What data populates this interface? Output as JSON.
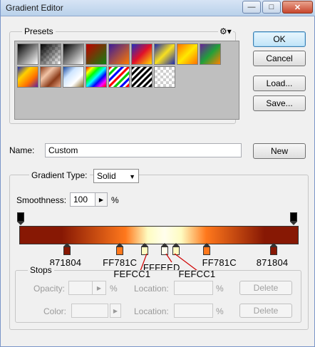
{
  "window": {
    "title": "Gradient Editor",
    "controls": [
      "minimize",
      "maximize",
      "close"
    ]
  },
  "presets": {
    "label": "Presets",
    "menu_icon": "gear-icon",
    "swatches": [
      {
        "name": "foreground-to-background",
        "css": "linear-gradient(135deg,#000,#fff)"
      },
      {
        "name": "foreground-to-transparent",
        "css": "checker-black"
      },
      {
        "name": "black-white",
        "css": "linear-gradient(135deg,#000,#fff)"
      },
      {
        "name": "red-green",
        "css": "linear-gradient(135deg,#c00000,#108010)"
      },
      {
        "name": "violet-orange",
        "css": "linear-gradient(135deg,#3a1b9a,#ff7a00)"
      },
      {
        "name": "blue-red-yellow",
        "css": "linear-gradient(135deg,#2030c0,#e0102a,#ffe000)"
      },
      {
        "name": "blue-yellow-blue",
        "css": "linear-gradient(135deg,#1c2ab0,#f8e020,#1c2ab0)"
      },
      {
        "name": "orange-yellow-orange",
        "css": "linear-gradient(135deg,#ff7000,#ffe800,#ff7000)"
      },
      {
        "name": "violet-green-orange",
        "css": "linear-gradient(135deg,#6a1f9a,#21a03a,#ff8000)"
      },
      {
        "name": "yellow-violet-orange-blue",
        "css": "linear-gradient(135deg,#1c2ab0,#ffd000,#ff7000,#6020a0)"
      },
      {
        "name": "copper",
        "css": "linear-gradient(135deg,#8c3c1a,#f2c4a6,#8c3c1a,#e8a886)"
      },
      {
        "name": "chrome",
        "css": "linear-gradient(135deg,#1a4aa0,#cfe6ff,#ffffff,#8a6a2a)"
      },
      {
        "name": "spectrum",
        "css": "linear-gradient(135deg,#f00,#ff0,#0f0,#0ff,#00f,#f0f,#f00)"
      },
      {
        "name": "transparent-rainbow",
        "css": "transparent-rainbow"
      },
      {
        "name": "transparent-stripes",
        "css": "transparent-stripes"
      },
      {
        "name": "neutral-density",
        "css": "checker"
      }
    ]
  },
  "buttons": {
    "ok": "OK",
    "cancel": "Cancel",
    "load": "Load...",
    "save": "Save...",
    "new": "New"
  },
  "name_field": {
    "label": "Name:",
    "value": "Custom"
  },
  "gradient_type": {
    "label": "Gradient Type:",
    "value": "Solid"
  },
  "smoothness": {
    "label": "Smoothness:",
    "value": "100",
    "unit": "%"
  },
  "gradient": {
    "css": "linear-gradient(to right,#871804 0%,#871804 15%,#ff781c 38%,#fefcc1 46%,#fffeed 52%,#fefcc1 58%,#ff781c 67%,#871804 88%,#871804 100%)",
    "color_stops": [
      {
        "hex": "871804",
        "color": "#871804",
        "location": 17
      },
      {
        "hex": "FF781C",
        "color": "#FF781C",
        "location": 36
      },
      {
        "hex": "FEFCC1",
        "color": "#FEFCC1",
        "location": 45
      },
      {
        "hex": "FFFEED",
        "color": "#FFFEED",
        "location": 52
      },
      {
        "hex": "FEFCC1",
        "color": "#FEFCC1",
        "location": 56
      },
      {
        "hex": "FF781C",
        "color": "#FF781C",
        "location": 67
      },
      {
        "hex": "871804",
        "color": "#871804",
        "location": 91
      }
    ],
    "opacity_stops": [
      {
        "location": 0,
        "opacity": 100
      },
      {
        "location": 100,
        "opacity": 100
      }
    ]
  },
  "stops": {
    "label": "Stops",
    "opacity_label": "Opacity:",
    "opacity_unit": "%",
    "color_label": "Color:",
    "location_label": "Location:",
    "location_unit": "%",
    "delete_label": "Delete"
  }
}
